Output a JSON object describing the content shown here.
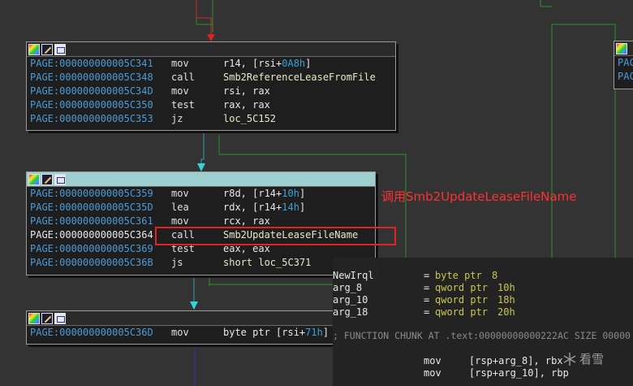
{
  "blocks": [
    {
      "rows": [
        {
          "addr": "PAGE:000000000005C341",
          "mn": "mov",
          "op": [
            "r14, [rsi+",
            "0A8h",
            "]"
          ]
        },
        {
          "addr": "PAGE:000000000005C348",
          "mn": "call",
          "op": [
            "Smb2ReferenceLeaseFromFile"
          ]
        },
        {
          "addr": "PAGE:000000000005C34D",
          "mn": "mov",
          "op": [
            "rsi, rax"
          ]
        },
        {
          "addr": "PAGE:000000000005C350",
          "mn": "test",
          "op": [
            "rax, rax"
          ]
        },
        {
          "addr": "PAGE:000000000005C353",
          "mn": "jz",
          "op": [
            "loc_5C152"
          ]
        }
      ]
    },
    {
      "rows": [
        {
          "addr": "PAGE:000000000005C359",
          "mn": "mov",
          "op": [
            "r8d, [r14+",
            "10h",
            "]"
          ]
        },
        {
          "addr": "PAGE:000000000005C35D",
          "mn": "lea",
          "op": [
            "rdx, [r14+",
            "14h",
            "]"
          ]
        },
        {
          "addr": "PAGE:000000000005C361",
          "mn": "mov",
          "op": [
            "rcx, rax"
          ]
        },
        {
          "addr": "PAGE:000000000005C364",
          "mn": "call",
          "op": [
            "Smb2UpdateLeaseFileName"
          ]
        },
        {
          "addr": "PAGE:000000000005C369",
          "mn": "test",
          "op": [
            "eax, eax"
          ]
        },
        {
          "addr": "PAGE:000000000005C36B",
          "mn": "js",
          "op": [
            "short loc_5C371"
          ]
        }
      ]
    },
    {
      "rows": [
        {
          "addr": "PAGE:000000000005C36D",
          "mn": "mov",
          "op": [
            "byte ptr [rsi+",
            "71h",
            "]"
          ]
        }
      ]
    }
  ],
  "right_block": {
    "rows": [
      "PAC",
      "PAC"
    ]
  },
  "annotation": "调用Smb2UpdateLeaseFileName",
  "panel": {
    "vars": [
      {
        "name": "NewIrql",
        "type": "byte ptr",
        "val": "8"
      },
      {
        "name": "arg_8",
        "type": "qword ptr",
        "val": "10h"
      },
      {
        "name": "arg_10",
        "type": "qword ptr",
        "val": "18h"
      },
      {
        "name": "arg_18",
        "type": "qword ptr",
        "val": "20h"
      }
    ],
    "chunk": "; FUNCTION CHUNK AT .text:00000000000222AC SIZE 00000",
    "code": [
      {
        "mn": "mov",
        "op": "[rsp+arg_8], rbx"
      },
      {
        "mn": "mov",
        "op": "[rsp+arg_10], rbp"
      }
    ]
  },
  "watermark": "看雪",
  "colors": {
    "background": "#333333",
    "addr": "#4d9bd6",
    "highlight": "#e02424",
    "edge_true": "#2ea0a8",
    "edge_false": "#cc2b2b",
    "edge_green": "#2f8f2f"
  }
}
